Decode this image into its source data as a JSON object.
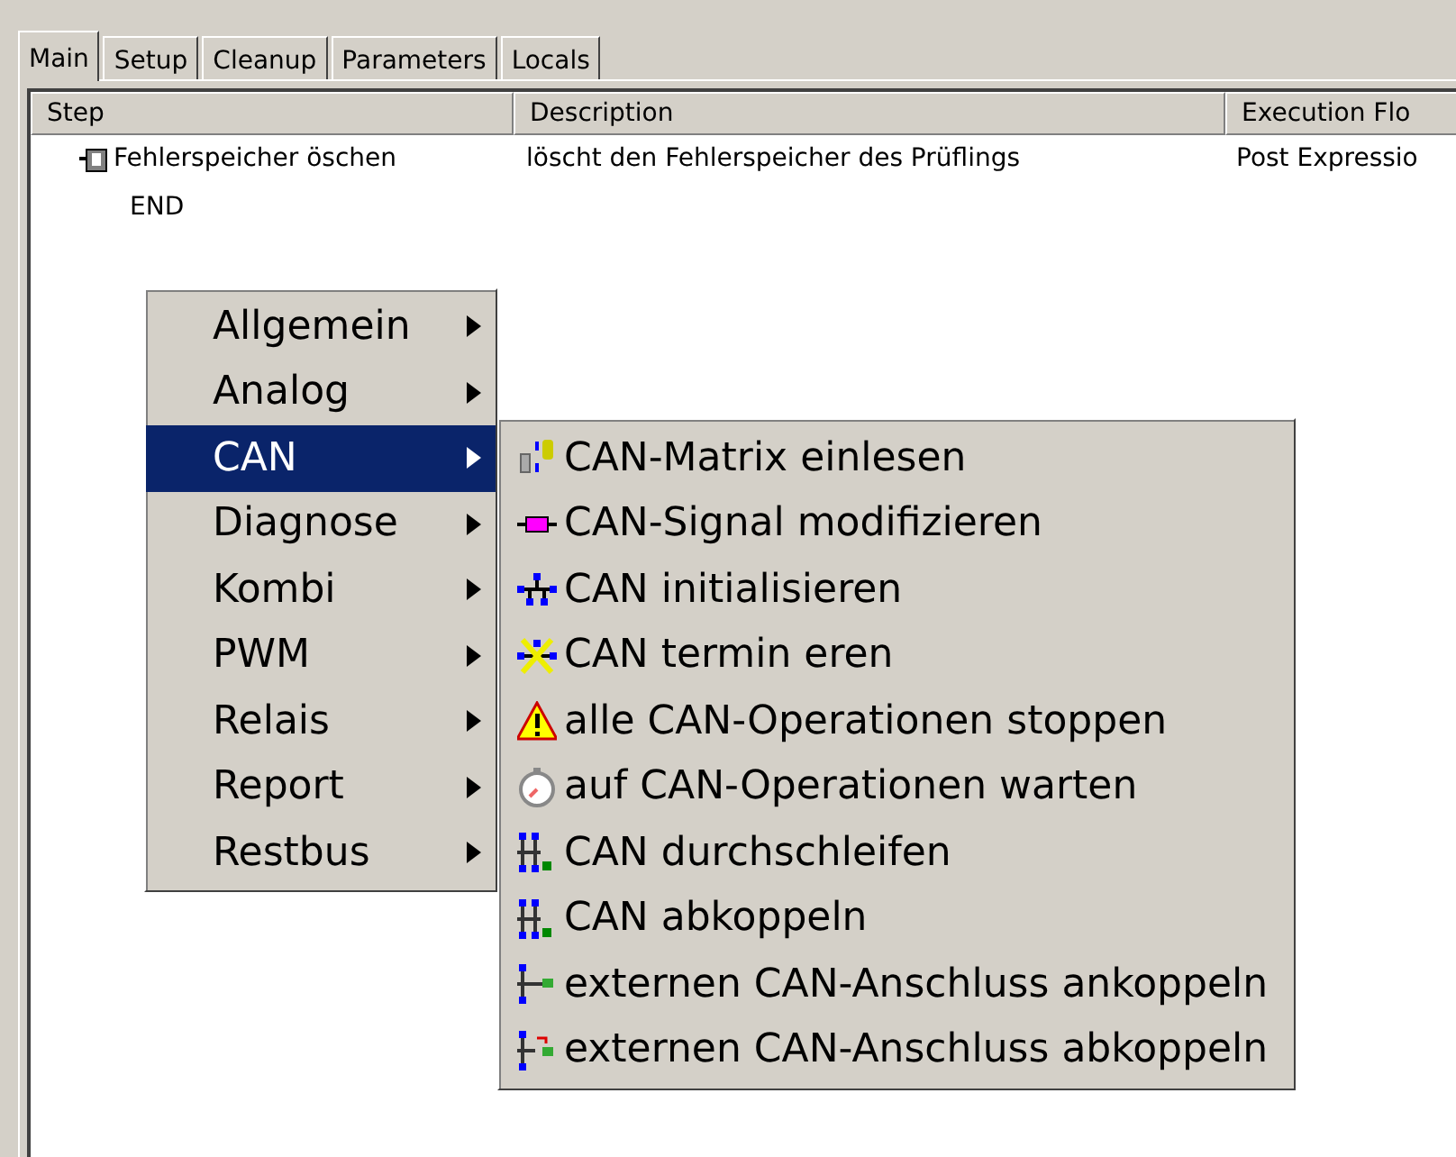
{
  "tabs": [
    {
      "label": "Main",
      "selected": true
    },
    {
      "label": "Setup",
      "selected": false
    },
    {
      "label": "Cleanup",
      "selected": false
    },
    {
      "label": "Parameters",
      "selected": false
    },
    {
      "label": "Locals",
      "selected": false
    }
  ],
  "table": {
    "columns": [
      "Step",
      "Description",
      "Execution Flo"
    ],
    "rows": [
      {
        "step": "Fehlerspeicher öschen",
        "description": "löscht den Fehlerspeicher des Prüflings",
        "execution_flow": "Post Expressio",
        "kind": "step"
      },
      {
        "step": "END",
        "kind": "end"
      }
    ]
  },
  "context_menu": {
    "items": [
      {
        "label": "Allgemein",
        "selected": false
      },
      {
        "label": "Analog",
        "selected": false
      },
      {
        "label": "CAN",
        "selected": true
      },
      {
        "label": "Diagnose",
        "selected": false
      },
      {
        "label": "Kombi",
        "selected": false
      },
      {
        "label": "PWM",
        "selected": false
      },
      {
        "label": "Relais",
        "selected": false
      },
      {
        "label": "Report",
        "selected": false
      },
      {
        "label": "Restbus",
        "selected": false
      }
    ]
  },
  "submenu": {
    "items": [
      {
        "label": "CAN-Matrix einlesen"
      },
      {
        "label": "CAN-Signal modifizieren"
      },
      {
        "label": "CAN initialisieren"
      },
      {
        "label": "CAN termin eren"
      },
      {
        "label": "alle CAN-Operationen stoppen"
      },
      {
        "label": "auf CAN-Operationen warten"
      },
      {
        "label": "CAN durchschleifen"
      },
      {
        "label": "CAN abkoppeln"
      },
      {
        "label": "externen CAN-Anschluss ankoppeln"
      },
      {
        "label": "externen CAN-Anschluss abkoppeln"
      }
    ]
  }
}
